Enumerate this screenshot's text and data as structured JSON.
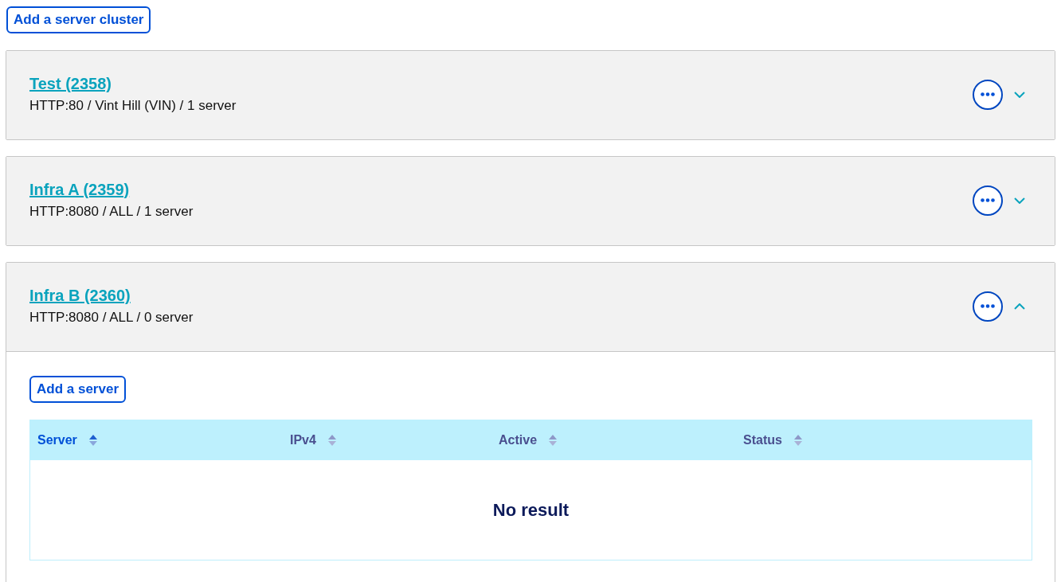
{
  "add_cluster_button": "Add a server cluster",
  "clusters": [
    {
      "name": "Test (2358)",
      "details": "HTTP:80 / Vint Hill (VIN) / 1 server",
      "expanded": false
    },
    {
      "name": "Infra A (2359)",
      "details": "HTTP:8080 / ALL / 1 server",
      "expanded": false
    },
    {
      "name": "Infra B (2360)",
      "details": "HTTP:8080 / ALL / 0 server",
      "expanded": true,
      "add_server_button": "Add a server",
      "table": {
        "columns": [
          {
            "label": "Server",
            "selected": true
          },
          {
            "label": "IPv4",
            "selected": false
          },
          {
            "label": "Active",
            "selected": false
          },
          {
            "label": "Status",
            "selected": false
          }
        ],
        "empty_message": "No result"
      }
    }
  ]
}
